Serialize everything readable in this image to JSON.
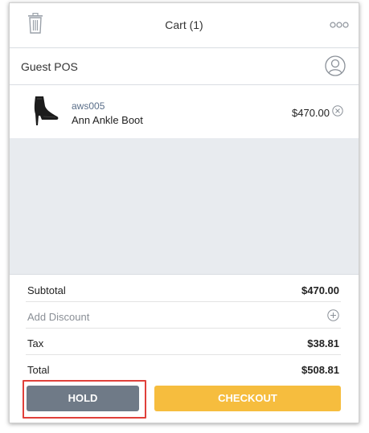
{
  "header": {
    "title": "Cart (1)",
    "left_icon": "trash-icon",
    "right_icon": "more-icon"
  },
  "customer": {
    "name": "Guest POS",
    "icon": "user-icon"
  },
  "items": [
    {
      "sku": "aws005",
      "name": "Ann Ankle Boot",
      "price": "$470.00",
      "image": "ankle-boot-image"
    }
  ],
  "summary": {
    "subtotal_label": "Subtotal",
    "subtotal_value": "$470.00",
    "discount_label": "Add Discount",
    "tax_label": "Tax",
    "tax_value": "$38.81",
    "total_label": "Total",
    "total_value": "$508.81"
  },
  "actions": {
    "hold_label": "HOLD",
    "checkout_label": "CHECKOUT"
  },
  "colors": {
    "hold": "#6f7a87",
    "checkout": "#f6bd3e",
    "highlight": "#e0403a",
    "empty_area": "#e8ebef"
  }
}
